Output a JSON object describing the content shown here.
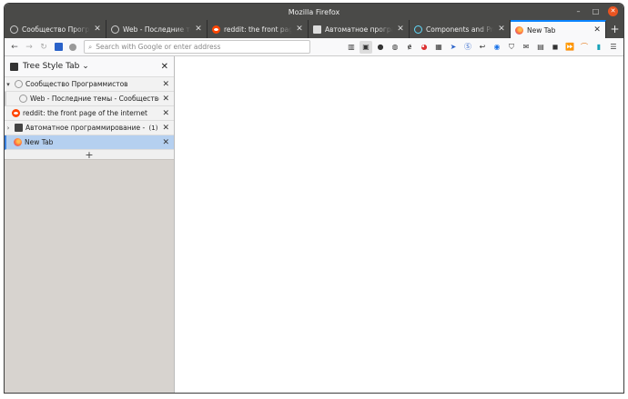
{
  "window": {
    "title": "Mozilla Firefox"
  },
  "tabs": [
    {
      "label": "Сообщество Программистов",
      "icon": "speech-bubble-icon"
    },
    {
      "label": "Web - Последние темы - Сообщество Программистов",
      "icon": "speech-bubble-icon"
    },
    {
      "label": "reddit: the front page of the internet",
      "icon": "reddit-icon"
    },
    {
      "label": "Автоматное программирование - JS: React",
      "icon": "robot-icon"
    },
    {
      "label": "Components and Props – React",
      "icon": "react-icon"
    },
    {
      "label": "New Tab",
      "icon": "firefox-icon",
      "active": true
    }
  ],
  "navbar": {
    "url_placeholder": "Search with Google or enter address"
  },
  "sidebar": {
    "title": "Tree Style Tab",
    "tree": [
      {
        "label": "Сообщество Программистов",
        "level": 0,
        "twisty": "▾"
      },
      {
        "label": "Web - Последние темы - Сообщество Программистов",
        "level": 1
      },
      {
        "label": "reddit: the front page of the internet",
        "level": 0
      },
      {
        "label": "Автоматное программирование - JS: React",
        "level": 0,
        "twisty": "›",
        "count": "(1)"
      },
      {
        "label": "New Tab",
        "level": 0,
        "active": true
      }
    ],
    "new_tab_symbol": "+"
  },
  "colors": {
    "accent": "#0a84ff",
    "sidebar_bg": "#d7d3cf",
    "active_tree_row": "#b5d0f0",
    "titlebar": "#4a4a48"
  }
}
